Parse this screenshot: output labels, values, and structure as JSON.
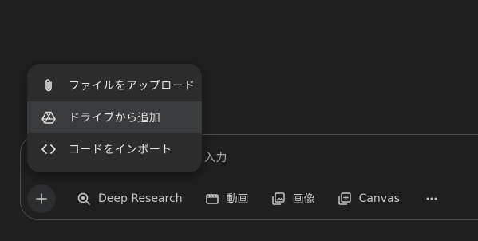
{
  "prompt": {
    "placeholder_visible": "入力"
  },
  "toolbar": {
    "tools": [
      {
        "label": "Deep Research",
        "icon": "deep-research-icon"
      },
      {
        "label": "動画",
        "icon": "video-icon"
      },
      {
        "label": "画像",
        "icon": "image-icon"
      },
      {
        "label": "Canvas",
        "icon": "canvas-icon"
      }
    ],
    "more_icon": "more-horizontal-icon",
    "add_icon": "plus-icon"
  },
  "menu": {
    "items": [
      {
        "label": "ファイルをアップロード",
        "icon": "paperclip-icon"
      },
      {
        "label": "ドライブから追加",
        "icon": "google-drive-icon"
      },
      {
        "label": "コードをインポート",
        "icon": "code-icon"
      }
    ]
  },
  "colors": {
    "background": "#1f1f1f",
    "menu_background": "#2c2c2d",
    "menu_hover": "#3a3b3d",
    "text": "#e3e3e3",
    "muted_text": "#c4c7c5",
    "border": "#4a4d4f"
  }
}
